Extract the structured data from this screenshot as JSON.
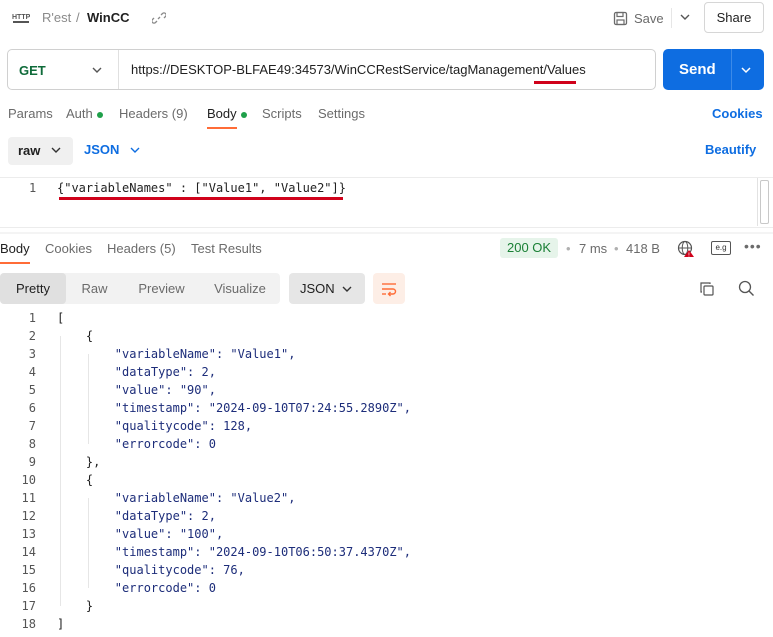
{
  "header": {
    "breadcrumb_parent": "R'est",
    "breadcrumb_separator": "/",
    "breadcrumb_current": "WinCC",
    "save_label": "Save",
    "share_label": "Share"
  },
  "request": {
    "method": "GET",
    "url": "https://DESKTOP-BLFAE49:34573/WinCCRestService/tagManagement/Values",
    "send_label": "Send",
    "tabs": [
      {
        "label": "Params"
      },
      {
        "label": "Auth",
        "dot": true
      },
      {
        "label": "Headers",
        "count": "(9)"
      },
      {
        "label": "Body",
        "dot": true,
        "active": true
      },
      {
        "label": "Scripts"
      },
      {
        "label": "Settings"
      }
    ],
    "cookies_label": "Cookies",
    "body_mode": "raw",
    "body_language": "JSON",
    "beautify_label": "Beautify",
    "body_line_number": "1",
    "body_text": "{\"variableNames\" : [\"Value1\", \"Value2\"]}"
  },
  "response": {
    "tabs": [
      {
        "label": "Body",
        "active": true
      },
      {
        "label": "Cookies"
      },
      {
        "label": "Headers",
        "count": "(5)"
      },
      {
        "label": "Test Results"
      }
    ],
    "status": "200 OK",
    "time": "7 ms",
    "size": "418 B",
    "example_label": "e.g",
    "view_modes": [
      "Pretty",
      "Raw",
      "Preview",
      "Visualize"
    ],
    "active_view": "Pretty",
    "format": "JSON",
    "lines": [
      "[",
      "    {",
      "        \"variableName\": \"Value1\",",
      "        \"dataType\": 2,",
      "        \"value\": \"90\",",
      "        \"timestamp\": \"2024-09-10T07:24:55.2890Z\",",
      "        \"qualitycode\": 128,",
      "        \"errorcode\": 0",
      "    },",
      "    {",
      "        \"variableName\": \"Value2\",",
      "        \"dataType\": 2,",
      "        \"value\": \"100\",",
      "        \"timestamp\": \"2024-09-10T06:50:37.4370Z\",",
      "        \"qualitycode\": 76,",
      "        \"errorcode\": 0",
      "    }",
      "]"
    ]
  },
  "colors": {
    "accent": "#ff6c37",
    "send": "#0e6de1",
    "method_get": "#0f6b3a",
    "status_ok": "#1a8035",
    "annotation_underline": "#d0021b"
  },
  "icons": [
    "http-icon",
    "link-icon",
    "save-icon",
    "chevron-down-icon",
    "globe-icon",
    "wrap-icon",
    "copy-icon",
    "search-icon",
    "more-icon"
  ]
}
